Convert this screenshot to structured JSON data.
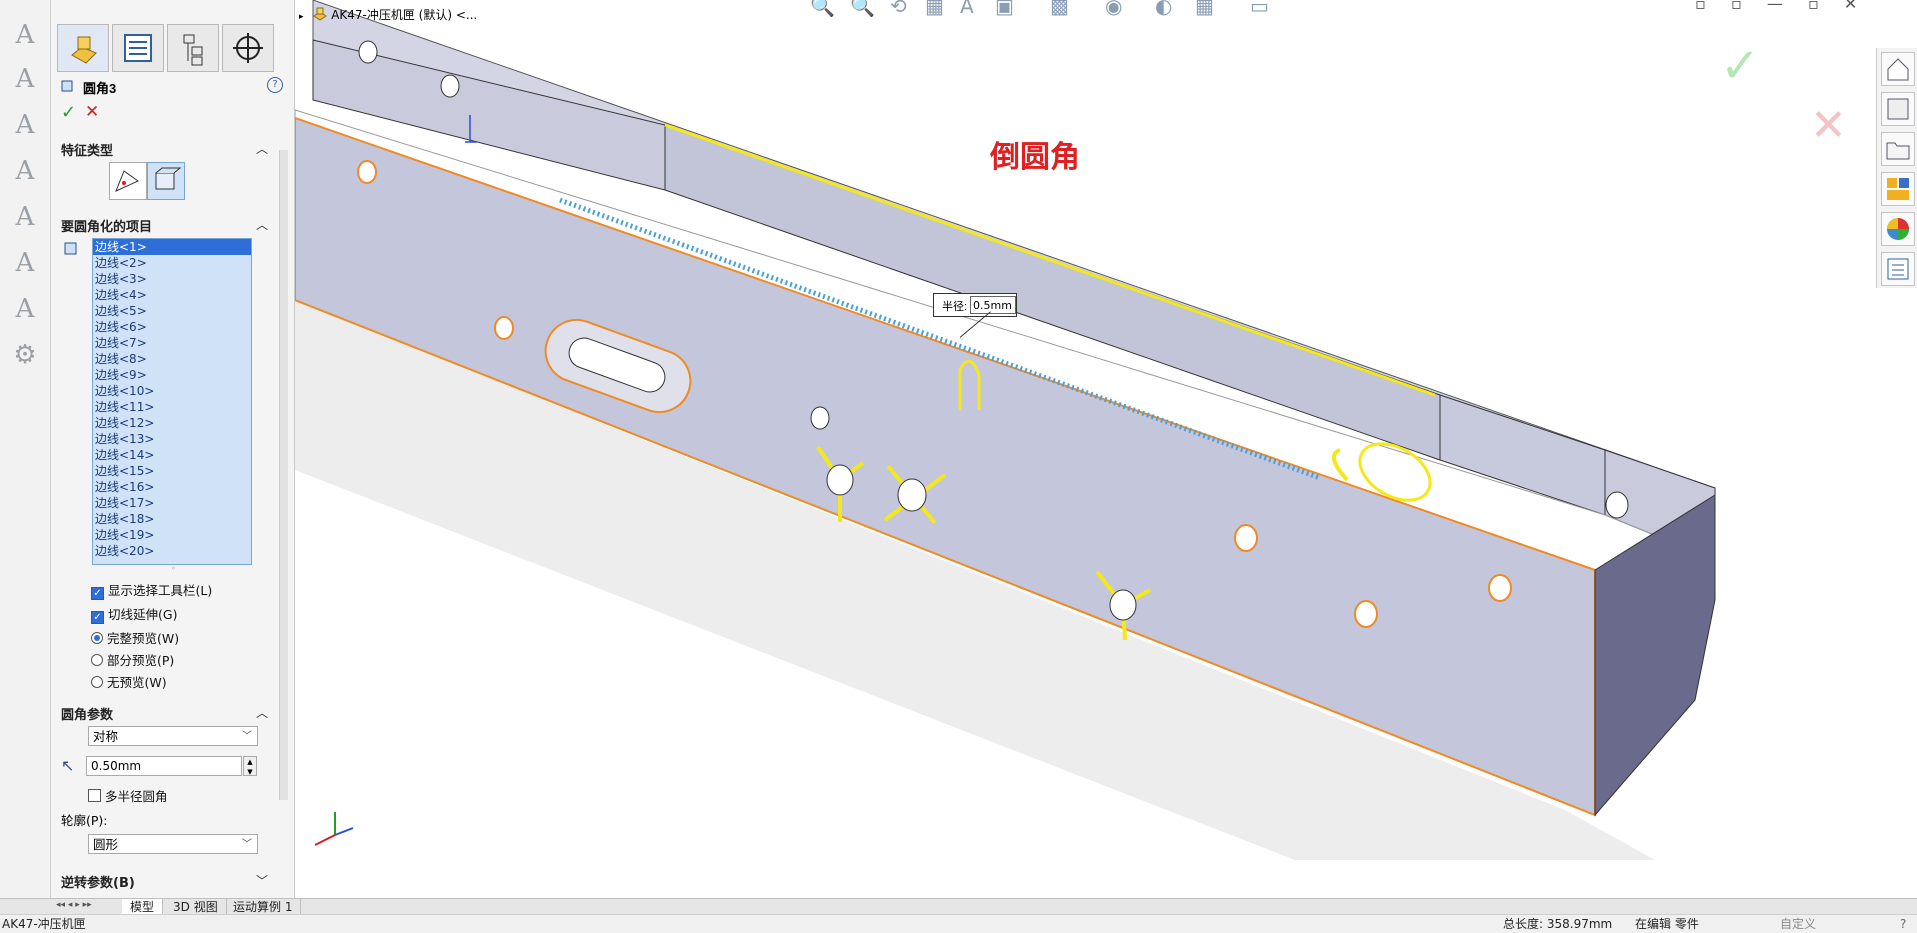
{
  "document": {
    "title": "AK47-冲压机匣 (默认) <...",
    "status_name": "AK47-冲压机匣"
  },
  "feature": {
    "name": "圆角3",
    "section_type": "特征类型",
    "section_items": "要圆角化的项目",
    "edges": [
      "边线<1>",
      "边线<2>",
      "边线<3>",
      "边线<4>",
      "边线<5>",
      "边线<6>",
      "边线<7>",
      "边线<8>",
      "边线<9>",
      "边线<10>",
      "边线<11>",
      "边线<12>",
      "边线<13>",
      "边线<14>",
      "边线<15>",
      "边线<16>",
      "边线<17>",
      "边线<18>",
      "边线<19>",
      "边线<20>"
    ],
    "options": {
      "show_toolbar": "显示选择工具栏(L)",
      "tangent": "切线延伸(G)",
      "full_preview": "完整预览(W)",
      "partial_preview": "部分预览(P)",
      "no_preview": "无预览(W)"
    },
    "params_title": "圆角参数",
    "symmetric": "对称",
    "radius_value": "0.50mm",
    "multi_radius": "多半径圆角",
    "profile_label": "轮廓(P):",
    "profile_value": "圆形",
    "reverse_title": "逆转参数(B)"
  },
  "viewport": {
    "annotation": "倒圆角",
    "callout_label": "半径:",
    "callout_value": "0.5mm",
    "annotation_color": "#e02020"
  },
  "tabs": [
    "模型",
    "3D 视图",
    "运动算例 1"
  ],
  "status": {
    "total_length": "总长度: 358.97mm",
    "editing": "在编辑 零件",
    "custom": "自定义"
  },
  "colors": {
    "selection_blue": "#2e6ed8",
    "edge_orange": "#f08a24",
    "highlight_yellow": "#f4e81a",
    "body": "#c4c6dc"
  }
}
